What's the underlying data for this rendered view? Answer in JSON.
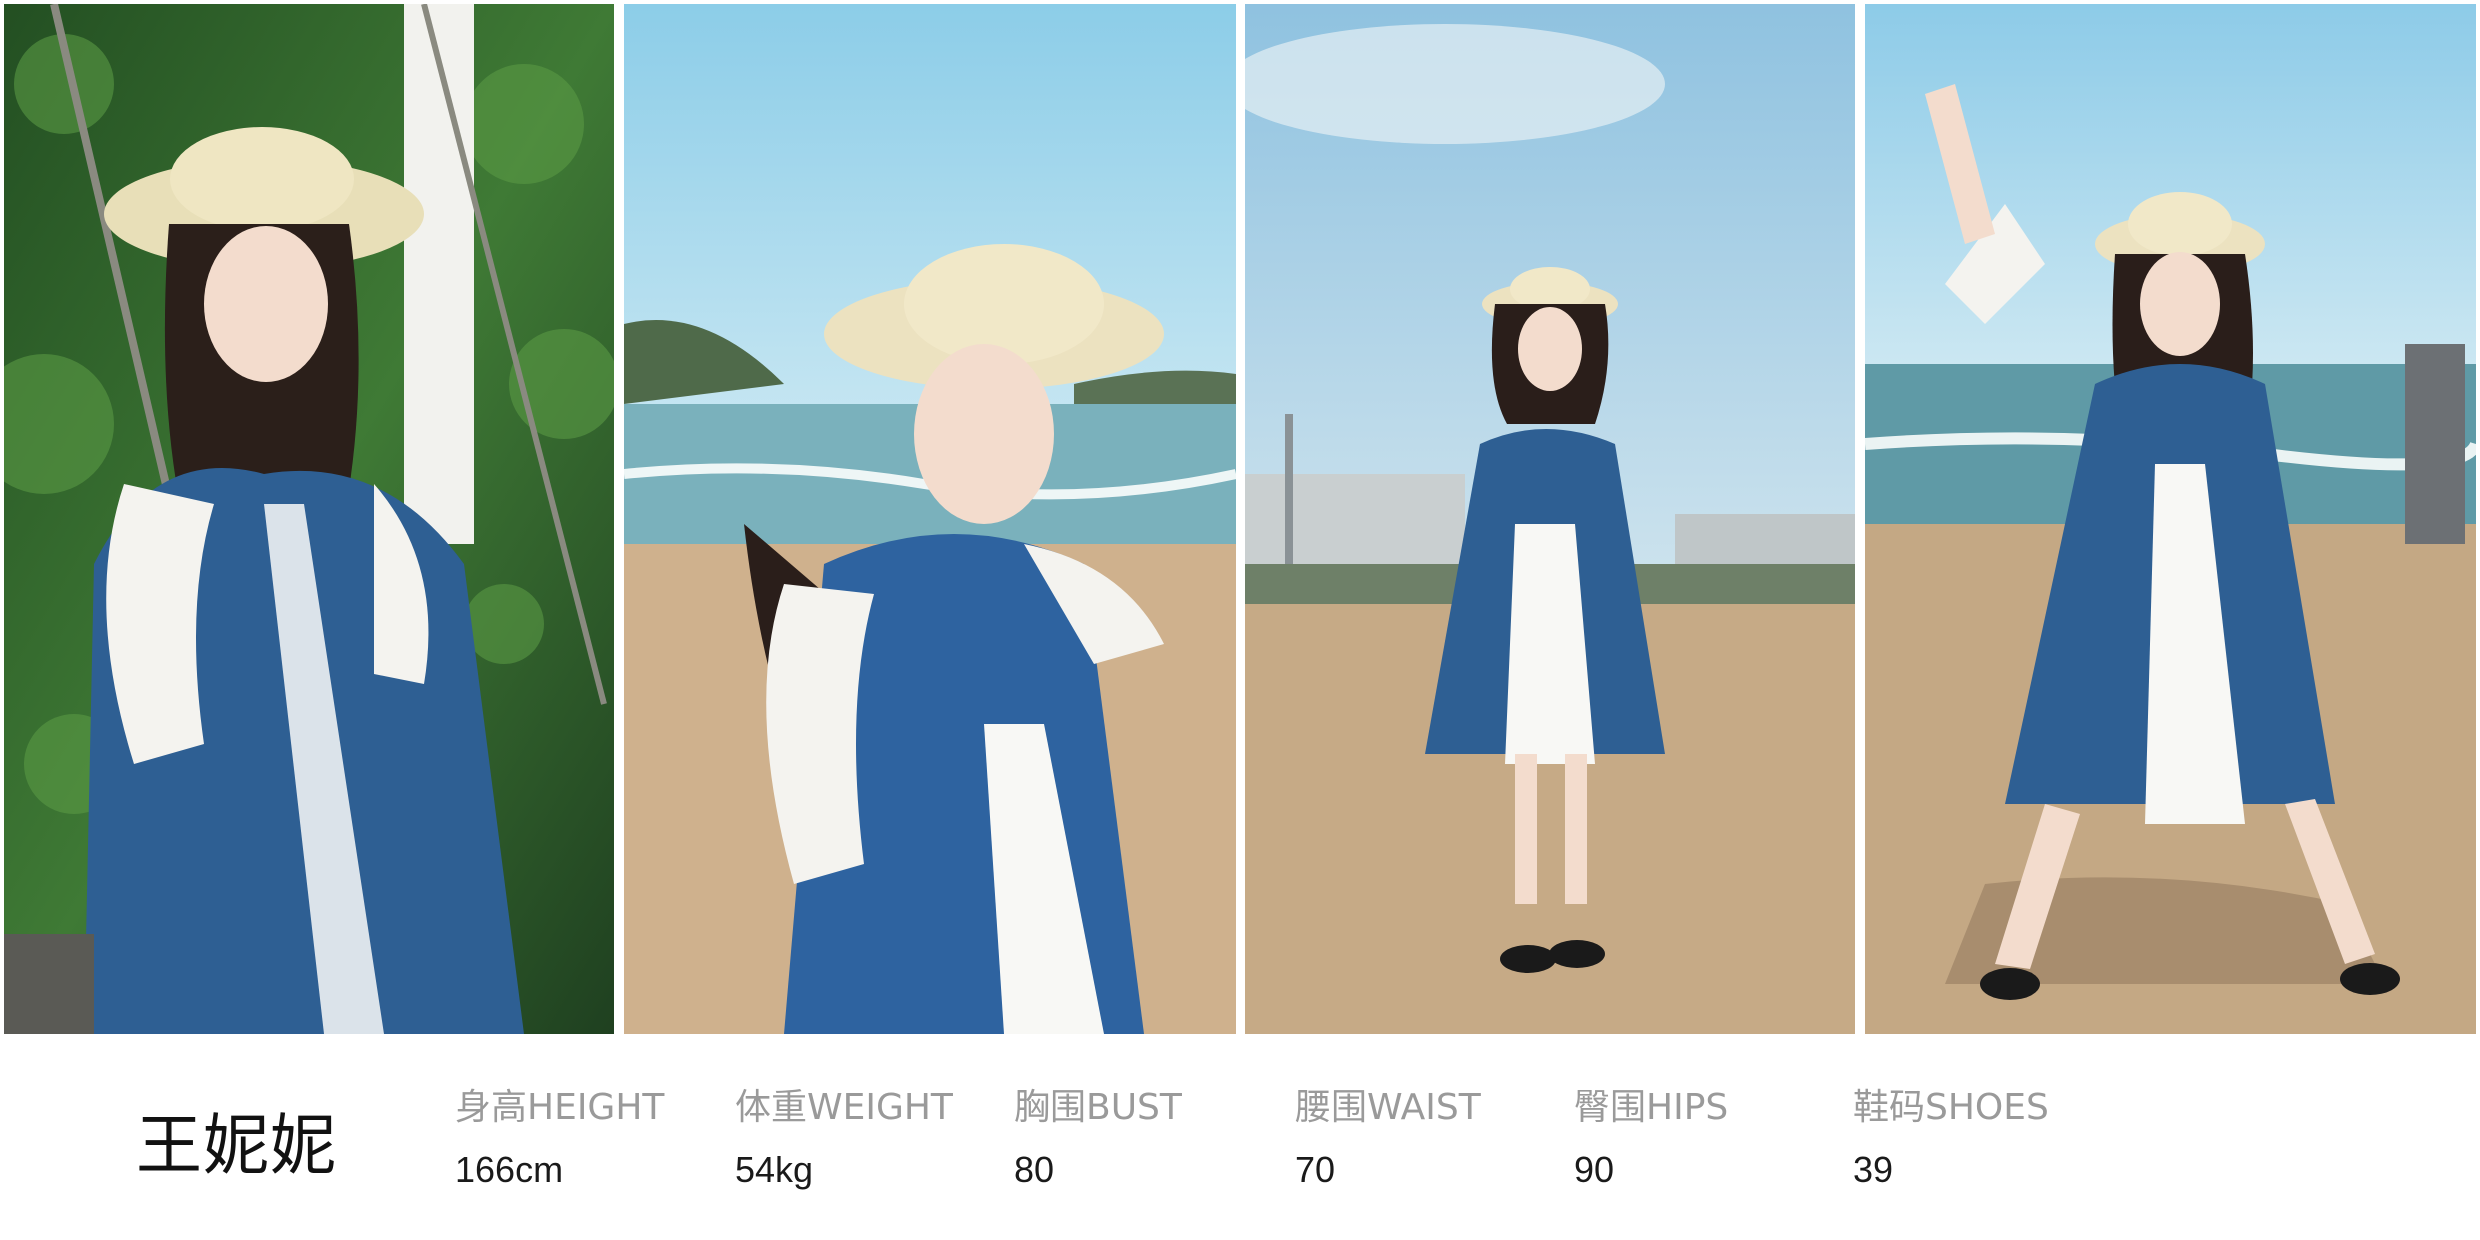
{
  "model": {
    "name": "王妮妮"
  },
  "measurements": [
    {
      "label": "身高HEIGHT",
      "value": "166cm"
    },
    {
      "label": "体重WEIGHT",
      "value": "54kg"
    },
    {
      "label": "胸围BUST",
      "value": "80"
    },
    {
      "label": "腰围WAIST",
      "value": "70"
    },
    {
      "label": "臀围HIPS",
      "value": "90"
    },
    {
      "label": "鞋码SHOES",
      "value": "39"
    }
  ],
  "colors": {
    "sky": "#a9d6ee",
    "sea": "#6fa9b8",
    "sand": "#c9ad8a",
    "dress_blue": "#2e5f93",
    "foliage": "#2f6b2c",
    "label_gray": "#9a9a9a",
    "value_dark": "#1a1a1a"
  }
}
